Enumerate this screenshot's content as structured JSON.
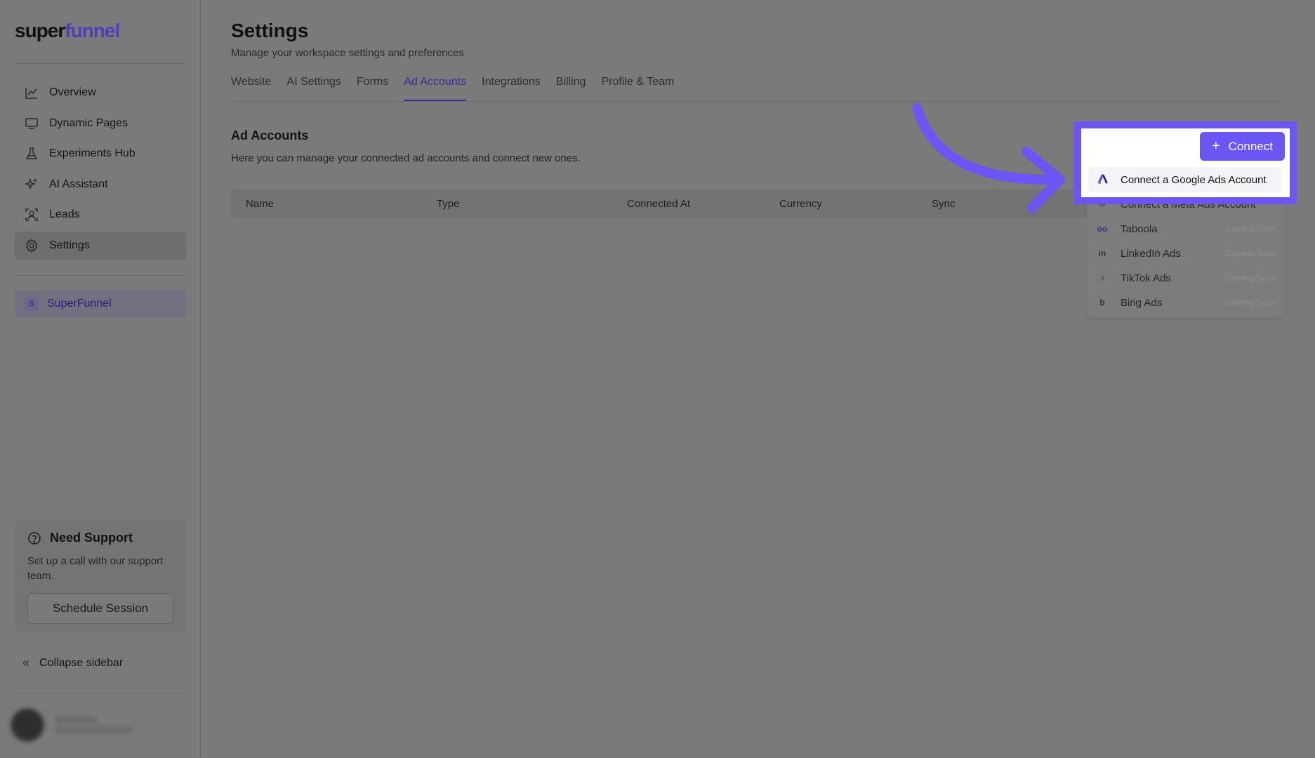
{
  "sidebar": {
    "logo_a": "super",
    "logo_b": "funnel",
    "nav": [
      {
        "label": "Overview",
        "icon": "chart-line-icon"
      },
      {
        "label": "Dynamic Pages",
        "icon": "monitor-icon"
      },
      {
        "label": "Experiments Hub",
        "icon": "flask-icon"
      },
      {
        "label": "AI Assistant",
        "icon": "sparkles-icon"
      },
      {
        "label": "Leads",
        "icon": "user-scan-icon"
      },
      {
        "label": "Settings",
        "icon": "gear-icon",
        "active": true
      }
    ],
    "workspace": {
      "badge": "S",
      "name": "SuperFunnel"
    },
    "support": {
      "title": "Need Support",
      "text": "Set up a call with our support team.",
      "button": "Schedule Session"
    },
    "collapse_label": "Collapse sidebar"
  },
  "header": {
    "title": "Settings",
    "subtitle": "Manage your workspace settings and preferences"
  },
  "tabs": [
    "Website",
    "AI Settings",
    "Forms",
    "Ad Accounts",
    "Integrations",
    "Billing",
    "Profile & Team"
  ],
  "active_tab": "Ad Accounts",
  "section": {
    "title": "Ad Accounts",
    "subtitle": "Here you can manage your connected ad accounts and connect new ones."
  },
  "table": {
    "columns": [
      "Name",
      "Type",
      "Connected At",
      "Currency",
      "Sync"
    ]
  },
  "connect": {
    "button_label": "Connect",
    "items": [
      {
        "label": "Connect a Google Ads Account",
        "icon": "google-ads-icon"
      },
      {
        "label": "Connect a Meta Ads Account",
        "icon": "meta-icon"
      },
      {
        "label": "Taboola",
        "icon": "taboola-icon",
        "status": "Coming Soon"
      },
      {
        "label": "LinkedIn Ads",
        "icon": "linkedin-icon",
        "status": "Coming Soon"
      },
      {
        "label": "TikTok Ads",
        "icon": "tiktok-icon",
        "status": "Coming Soon"
      },
      {
        "label": "Bing Ads",
        "icon": "bing-icon",
        "status": "Coming Soon"
      }
    ]
  },
  "colors": {
    "accent": "#6c55f5",
    "active_tab": "#3a2b9c"
  }
}
